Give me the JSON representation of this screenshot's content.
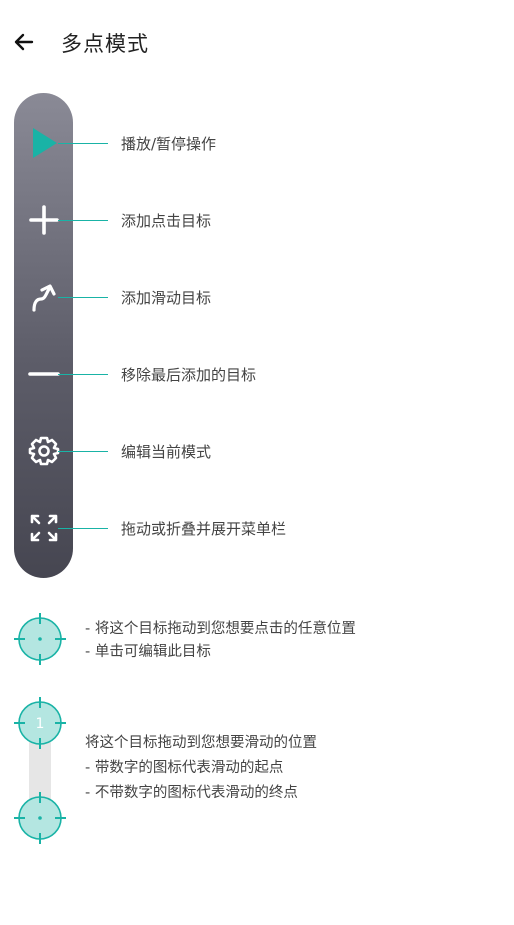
{
  "app_bar": {
    "title": "多点模式"
  },
  "toolbar": {
    "items": [
      {
        "label": "播放/暂停操作"
      },
      {
        "label": "添加点击目标"
      },
      {
        "label": "添加滑动目标"
      },
      {
        "label": "移除最后添加的目标"
      },
      {
        "label": "编辑当前模式"
      },
      {
        "label": "拖动或折叠并展开菜单栏"
      }
    ]
  },
  "click_target": {
    "lines": [
      "- 将这个目标拖动到您想要点击的任意位置",
      "- 单击可编辑此目标"
    ]
  },
  "swipe_target": {
    "number": "1",
    "lines": [
      "将这个目标拖动到您想要滑动的位置",
      "- 带数字的图标代表滑动的起点",
      "- 不带数字的图标代表滑动的终点"
    ]
  },
  "colors": {
    "accent": "#19b3a6",
    "toolbar_top": "#8a8a96",
    "toolbar_bottom": "#464651"
  }
}
